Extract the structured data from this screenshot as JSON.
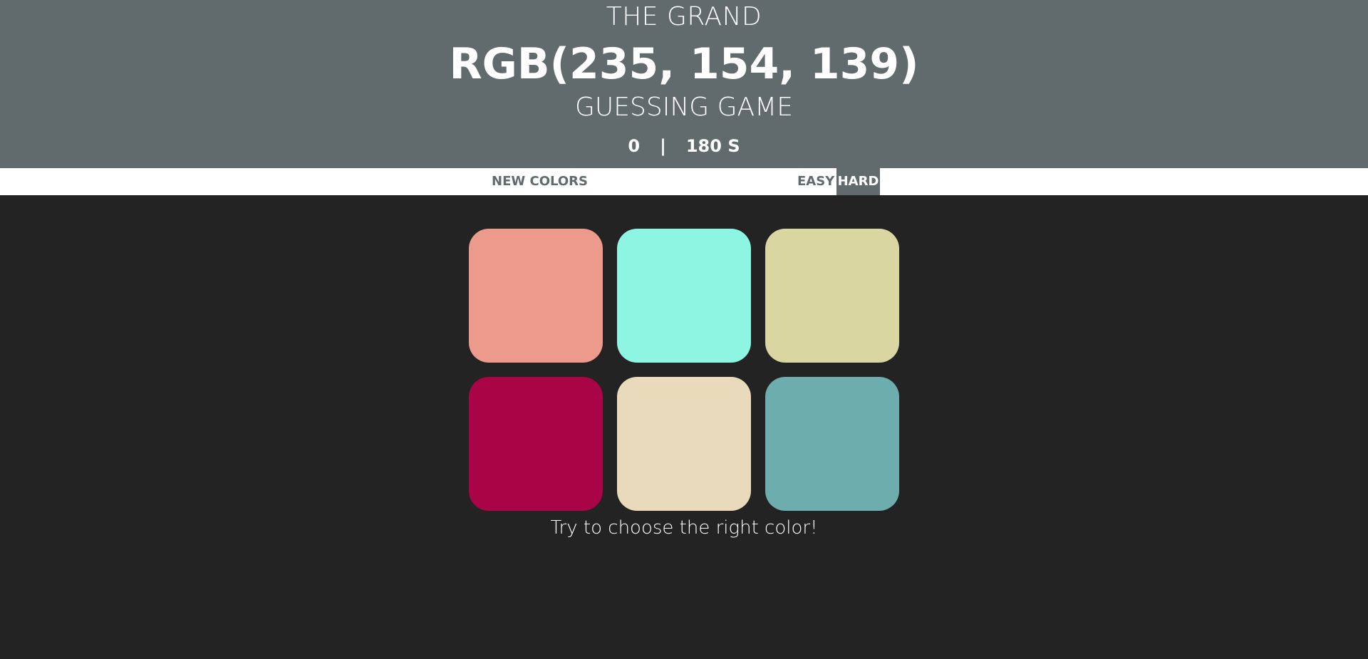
{
  "header": {
    "title_top": "THE GRAND",
    "rgb": "RGB(235, 154, 139)",
    "title_bottom": "GUESSING GAME",
    "score": "0",
    "separator": "|",
    "timer": "180 S"
  },
  "controls": {
    "new_colors": "NEW COLORS",
    "easy": "EASY",
    "hard": "HARD"
  },
  "squares": [
    {
      "color": "#eb9a8b"
    },
    {
      "color": "#8df5e2"
    },
    {
      "color": "#d9d6a1"
    },
    {
      "color": "#a80446"
    },
    {
      "color": "#e9dabb"
    },
    {
      "color": "#6eadae"
    }
  ],
  "message": "Try to choose the right color!"
}
